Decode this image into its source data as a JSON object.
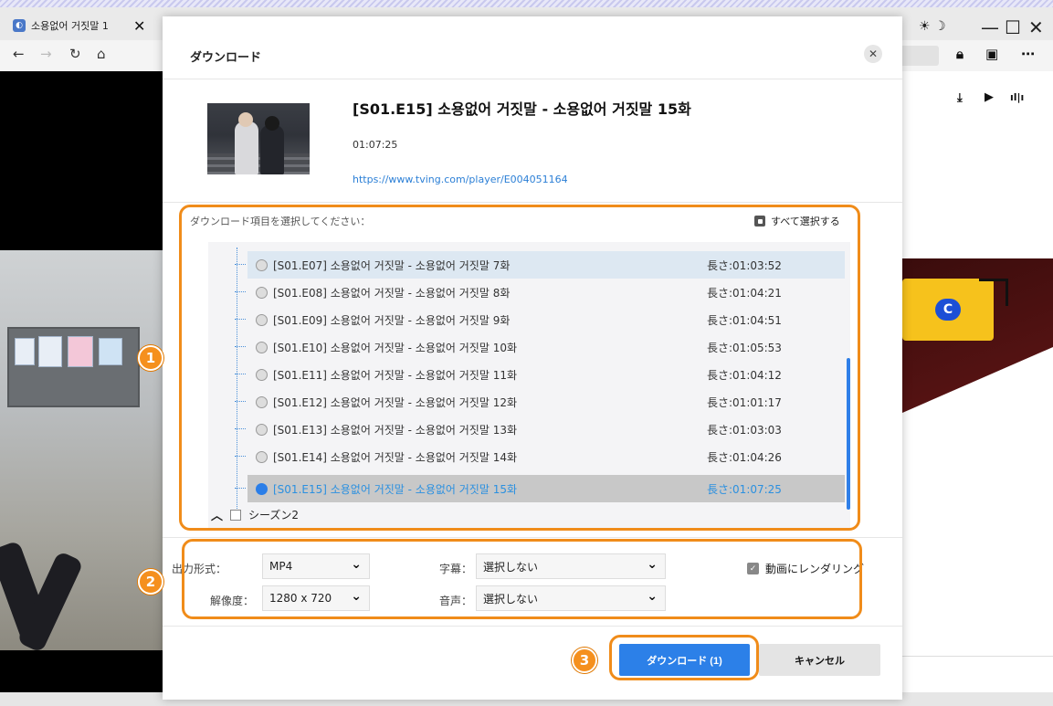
{
  "browser": {
    "tab_title": "소용없어 거짓말 1",
    "tab_close": "✕",
    "favicon": "tving-icon",
    "window_controls": [
      "—",
      "☐",
      "✕"
    ],
    "nav": [
      "←",
      "→",
      "↻",
      "⌂"
    ],
    "toolbar_icons": [
      "download-icon",
      "youtube-icon",
      "audio-icon"
    ]
  },
  "dialog": {
    "title": "ダウンロード",
    "close": "✕",
    "episode": {
      "title": "[S01.E15] 소용없어 거짓말 - 소용없어 거짓말 15화",
      "duration": "01:07:25",
      "url": "https://www.tving.com/player/E004051164"
    },
    "select_prompt": "ダウンロード項目を選択してください：",
    "select_all": "すべて選択する",
    "items": [
      {
        "title": "[S01.E07] 소용없어 거짓말 - 소용없어 거짓말 7화",
        "length": "長さ:01:03:52"
      },
      {
        "title": "[S01.E08] 소용없어 거짓말 - 소용없어 거짓말 8화",
        "length": "長さ:01:04:21"
      },
      {
        "title": "[S01.E09] 소용없어 거짓말 - 소용없어 거짓말 9화",
        "length": "長さ:01:04:51"
      },
      {
        "title": "[S01.E10] 소용없어 거짓말 - 소용없어 거짓말 10화",
        "length": "長さ:01:05:53"
      },
      {
        "title": "[S01.E11] 소용없어 거짓말 - 소용없어 거짓말 11화",
        "length": "長さ:01:04:12"
      },
      {
        "title": "[S01.E12] 소용없어 거짓말 - 소용없어 거짓말 12화",
        "length": "長さ:01:01:17"
      },
      {
        "title": "[S01.E13] 소용없어 거짓말 - 소용없어 거짓말 13화",
        "length": "長さ:01:03:03"
      },
      {
        "title": "[S01.E14] 소용없어 거짓말 - 소용없어 거짓말 14화",
        "length": "長さ:01:04:26"
      },
      {
        "title": "[S01.E15] 소용없어 거짓말 - 소용없어 거짓말 15화",
        "length": "長さ:01:07:25"
      }
    ],
    "season2": "シーズン2",
    "output": {
      "format_label": "出力形式：",
      "format_value": "MP4",
      "resolution_label": "解像度：",
      "resolution_value": "1280 x 720",
      "subtitle_label": "字幕：",
      "subtitle_value": "選択しない",
      "audio_label": "音声：",
      "audio_value": "選択しない",
      "render_label": "動画にレンダリング"
    },
    "download_button": "ダウンロード (1)",
    "cancel_button": "キャンセル"
  },
  "markers": [
    "1",
    "2",
    "3"
  ],
  "colors": {
    "accent": "#2c80e8",
    "annotation": "#f08c1a",
    "selected_text": "#2b90e0"
  }
}
